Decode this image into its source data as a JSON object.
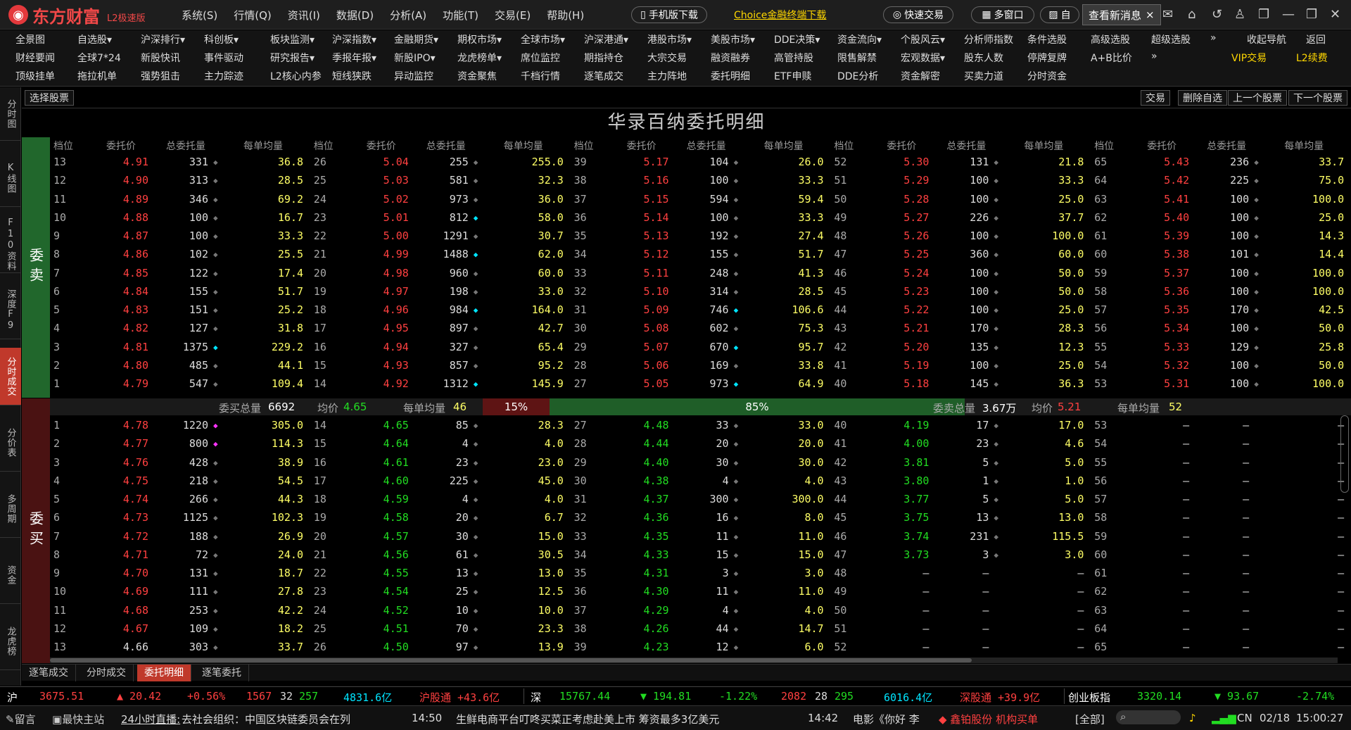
{
  "app": {
    "logo_text": "东方财富",
    "logo_sub": "L2极速版",
    "menu": [
      "系统(S)",
      "行情(Q)",
      "资讯(I)",
      "数据(D)",
      "分析(A)",
      "功能(T)",
      "交易(E)",
      "帮助(H)"
    ],
    "mobile_download": "手机版下载",
    "choice_link": "Choice金融终端下载",
    "quick_trade": "快速交易",
    "multi_window": "多窗口",
    "self_label": "自",
    "new_msg": "查看新消息",
    "close_x": "×"
  },
  "toolbar": {
    "row1": [
      "全景图",
      "自选股▾",
      "沪深排行▾",
      "科创板▾",
      "板块监测▾",
      "沪深指数▾",
      "金融期货▾",
      "期权市场▾",
      "全球市场▾",
      "沪深港通▾",
      "港股市场▾",
      "美股市场▾",
      "DDE决策▾",
      "资金流向▾",
      "个股风云▾",
      "分析师指数",
      "条件选股",
      "高级选股",
      "超级选股",
      "»",
      "收起导航",
      "返回"
    ],
    "row2": [
      "财经要闻",
      "全球7*24",
      "新股快讯",
      "事件驱动",
      "研究报告▾",
      "季报年报▾",
      "新股IPO▾",
      "龙虎榜单▾",
      "席位监控",
      "期指持仓",
      "大宗交易",
      "融资融券",
      "高管持股",
      "限售解禁",
      "宏观数据▾",
      "股东人数",
      "停牌复牌",
      "A+B比价",
      "»",
      "VIP交易",
      "L2续费"
    ],
    "row3": [
      "顶级挂单",
      "拖拉机单",
      "强势狙击",
      "主力踪迹",
      "L2核心内参",
      "短线狭跌",
      "异动监控",
      "资金聚焦",
      "千档行情",
      "逐笔成交",
      "主力阵地",
      "委托明细",
      "ETF申赎",
      "DDE分析",
      "资金解密",
      "买卖力道",
      "分时资金"
    ]
  },
  "left_tabs": [
    "分时图",
    "K线图",
    "F10资料",
    "深度F9",
    "分时成交",
    "分价表",
    "多周期",
    "资金",
    "龙虎榜"
  ],
  "subbar": {
    "select_stock": "选择股票",
    "trade": "交易",
    "remove_fav": "删除自选",
    "prev_stock": "上一个股票",
    "next_stock": "下一个股票"
  },
  "panel_title": "华录百纳委托明细",
  "columns": [
    "档位",
    "委托价",
    "总委托量",
    "每单均量"
  ],
  "sell_label": "委卖",
  "buy_label": "委买",
  "sell_rows": [
    [
      [
        "13",
        "4.91",
        "331",
        "g",
        "36.8"
      ],
      [
        "26",
        "5.04",
        "255",
        "g",
        "255.0"
      ],
      [
        "39",
        "5.17",
        "104",
        "g",
        "26.0"
      ],
      [
        "52",
        "5.30",
        "131",
        "g",
        "21.8"
      ],
      [
        "65",
        "5.43",
        "236",
        "g",
        "33.7"
      ]
    ],
    [
      [
        "12",
        "4.90",
        "313",
        "g",
        "28.5"
      ],
      [
        "25",
        "5.03",
        "581",
        "g",
        "32.3"
      ],
      [
        "38",
        "5.16",
        "100",
        "g",
        "33.3"
      ],
      [
        "51",
        "5.29",
        "100",
        "g",
        "33.3"
      ],
      [
        "64",
        "5.42",
        "225",
        "g",
        "75.0"
      ]
    ],
    [
      [
        "11",
        "4.89",
        "346",
        "g",
        "69.2"
      ],
      [
        "24",
        "5.02",
        "973",
        "g",
        "36.0"
      ],
      [
        "37",
        "5.15",
        "594",
        "g",
        "59.4"
      ],
      [
        "50",
        "5.28",
        "100",
        "g",
        "25.0"
      ],
      [
        "63",
        "5.41",
        "100",
        "g",
        "100.0"
      ]
    ],
    [
      [
        "10",
        "4.88",
        "100",
        "g",
        "16.7"
      ],
      [
        "23",
        "5.01",
        "812",
        "c",
        "58.0"
      ],
      [
        "36",
        "5.14",
        "100",
        "g",
        "33.3"
      ],
      [
        "49",
        "5.27",
        "226",
        "g",
        "37.7"
      ],
      [
        "62",
        "5.40",
        "100",
        "g",
        "25.0"
      ]
    ],
    [
      [
        "9",
        "4.87",
        "100",
        "g",
        "33.3"
      ],
      [
        "22",
        "5.00",
        "1291",
        "g",
        "30.7"
      ],
      [
        "35",
        "5.13",
        "192",
        "g",
        "27.4"
      ],
      [
        "48",
        "5.26",
        "100",
        "g",
        "100.0"
      ],
      [
        "61",
        "5.39",
        "100",
        "g",
        "14.3"
      ]
    ],
    [
      [
        "8",
        "4.86",
        "102",
        "g",
        "25.5"
      ],
      [
        "21",
        "4.99",
        "1488",
        "c",
        "62.0"
      ],
      [
        "34",
        "5.12",
        "155",
        "g",
        "51.7"
      ],
      [
        "47",
        "5.25",
        "360",
        "g",
        "60.0"
      ],
      [
        "60",
        "5.38",
        "101",
        "g",
        "14.4"
      ]
    ],
    [
      [
        "7",
        "4.85",
        "122",
        "g",
        "17.4"
      ],
      [
        "20",
        "4.98",
        "960",
        "g",
        "60.0"
      ],
      [
        "33",
        "5.11",
        "248",
        "g",
        "41.3"
      ],
      [
        "46",
        "5.24",
        "100",
        "g",
        "50.0"
      ],
      [
        "59",
        "5.37",
        "100",
        "g",
        "100.0"
      ]
    ],
    [
      [
        "6",
        "4.84",
        "155",
        "g",
        "51.7"
      ],
      [
        "19",
        "4.97",
        "198",
        "g",
        "33.0"
      ],
      [
        "32",
        "5.10",
        "314",
        "g",
        "28.5"
      ],
      [
        "45",
        "5.23",
        "100",
        "g",
        "50.0"
      ],
      [
        "58",
        "5.36",
        "100",
        "g",
        "100.0"
      ]
    ],
    [
      [
        "5",
        "4.83",
        "151",
        "g",
        "25.2"
      ],
      [
        "18",
        "4.96",
        "984",
        "c",
        "164.0"
      ],
      [
        "31",
        "5.09",
        "746",
        "c",
        "106.6"
      ],
      [
        "44",
        "5.22",
        "100",
        "g",
        "25.0"
      ],
      [
        "57",
        "5.35",
        "170",
        "g",
        "42.5"
      ]
    ],
    [
      [
        "4",
        "4.82",
        "127",
        "g",
        "31.8"
      ],
      [
        "17",
        "4.95",
        "897",
        "g",
        "42.7"
      ],
      [
        "30",
        "5.08",
        "602",
        "g",
        "75.3"
      ],
      [
        "43",
        "5.21",
        "170",
        "g",
        "28.3"
      ],
      [
        "56",
        "5.34",
        "100",
        "g",
        "50.0"
      ]
    ],
    [
      [
        "3",
        "4.81",
        "1375",
        "c",
        "229.2"
      ],
      [
        "16",
        "4.94",
        "327",
        "g",
        "65.4"
      ],
      [
        "29",
        "5.07",
        "670",
        "c",
        "95.7"
      ],
      [
        "42",
        "5.20",
        "135",
        "g",
        "12.3"
      ],
      [
        "55",
        "5.33",
        "129",
        "g",
        "25.8"
      ]
    ],
    [
      [
        "2",
        "4.80",
        "485",
        "g",
        "44.1"
      ],
      [
        "15",
        "4.93",
        "857",
        "g",
        "95.2"
      ],
      [
        "28",
        "5.06",
        "169",
        "g",
        "33.8"
      ],
      [
        "41",
        "5.19",
        "100",
        "g",
        "25.0"
      ],
      [
        "54",
        "5.32",
        "100",
        "g",
        "50.0"
      ]
    ],
    [
      [
        "1",
        "4.79",
        "547",
        "g",
        "109.4"
      ],
      [
        "14",
        "4.92",
        "1312",
        "c",
        "145.9"
      ],
      [
        "27",
        "5.05",
        "973",
        "c",
        "64.9"
      ],
      [
        "40",
        "5.18",
        "145",
        "g",
        "36.3"
      ],
      [
        "53",
        "5.31",
        "100",
        "g",
        "100.0"
      ]
    ]
  ],
  "summary": {
    "buy_total_label": "委买总量",
    "buy_total": "6692",
    "buy_avg_label": "均价",
    "buy_avg": "4.65",
    "buy_per_label": "每单均量",
    "buy_per": "46",
    "buy_pct": "15%",
    "sell_pct": "85%",
    "sell_total_label": "委卖总量",
    "sell_total": "3.67万",
    "sell_avg_label": "均价",
    "sell_avg": "5.21",
    "sell_per_label": "每单均量",
    "sell_per": "52"
  },
  "buy_rows": [
    [
      [
        "1",
        "4.78",
        "1220",
        "m",
        "305.0"
      ],
      [
        "14",
        "4.65",
        "85",
        "g",
        "28.3"
      ],
      [
        "27",
        "4.48",
        "33",
        "g",
        "33.0"
      ],
      [
        "40",
        "4.19",
        "17",
        "g",
        "17.0"
      ],
      [
        "53",
        "—",
        "—",
        "",
        "—"
      ]
    ],
    [
      [
        "2",
        "4.77",
        "800",
        "m",
        "114.3"
      ],
      [
        "15",
        "4.64",
        "4",
        "g",
        "4.0"
      ],
      [
        "28",
        "4.44",
        "20",
        "g",
        "20.0"
      ],
      [
        "41",
        "4.00",
        "23",
        "g",
        "4.6"
      ],
      [
        "54",
        "—",
        "—",
        "",
        "—"
      ]
    ],
    [
      [
        "3",
        "4.76",
        "428",
        "g",
        "38.9"
      ],
      [
        "16",
        "4.61",
        "23",
        "g",
        "23.0"
      ],
      [
        "29",
        "4.40",
        "30",
        "g",
        "30.0"
      ],
      [
        "42",
        "3.81",
        "5",
        "g",
        "5.0"
      ],
      [
        "55",
        "—",
        "—",
        "",
        "—"
      ]
    ],
    [
      [
        "4",
        "4.75",
        "218",
        "g",
        "54.5"
      ],
      [
        "17",
        "4.60",
        "225",
        "g",
        "45.0"
      ],
      [
        "30",
        "4.38",
        "4",
        "g",
        "4.0"
      ],
      [
        "43",
        "3.80",
        "1",
        "g",
        "1.0"
      ],
      [
        "56",
        "—",
        "—",
        "",
        "—"
      ]
    ],
    [
      [
        "5",
        "4.74",
        "266",
        "g",
        "44.3"
      ],
      [
        "18",
        "4.59",
        "4",
        "g",
        "4.0"
      ],
      [
        "31",
        "4.37",
        "300",
        "g",
        "300.0"
      ],
      [
        "44",
        "3.77",
        "5",
        "g",
        "5.0"
      ],
      [
        "57",
        "—",
        "—",
        "",
        "—"
      ]
    ],
    [
      [
        "6",
        "4.73",
        "1125",
        "g",
        "102.3"
      ],
      [
        "19",
        "4.58",
        "20",
        "g",
        "6.7"
      ],
      [
        "32",
        "4.36",
        "16",
        "g",
        "8.0"
      ],
      [
        "45",
        "3.75",
        "13",
        "g",
        "13.0"
      ],
      [
        "58",
        "—",
        "—",
        "",
        "—"
      ]
    ],
    [
      [
        "7",
        "4.72",
        "188",
        "g",
        "26.9"
      ],
      [
        "20",
        "4.57",
        "30",
        "g",
        "15.0"
      ],
      [
        "33",
        "4.35",
        "11",
        "g",
        "11.0"
      ],
      [
        "46",
        "3.74",
        "231",
        "g",
        "115.5"
      ],
      [
        "59",
        "—",
        "—",
        "",
        "—"
      ]
    ],
    [
      [
        "8",
        "4.71",
        "72",
        "g",
        "24.0"
      ],
      [
        "21",
        "4.56",
        "61",
        "g",
        "30.5"
      ],
      [
        "34",
        "4.33",
        "15",
        "g",
        "15.0"
      ],
      [
        "47",
        "3.73",
        "3",
        "g",
        "3.0"
      ],
      [
        "60",
        "—",
        "—",
        "",
        "—"
      ]
    ],
    [
      [
        "9",
        "4.70",
        "131",
        "g",
        "18.7"
      ],
      [
        "22",
        "4.55",
        "13",
        "g",
        "13.0"
      ],
      [
        "35",
        "4.31",
        "3",
        "g",
        "3.0"
      ],
      [
        "48",
        "—",
        "—",
        "",
        "—"
      ],
      [
        "61",
        "—",
        "—",
        "",
        "—"
      ]
    ],
    [
      [
        "10",
        "4.69",
        "111",
        "g",
        "27.8"
      ],
      [
        "23",
        "4.54",
        "25",
        "g",
        "12.5"
      ],
      [
        "36",
        "4.30",
        "11",
        "g",
        "11.0"
      ],
      [
        "49",
        "—",
        "—",
        "",
        "—"
      ],
      [
        "62",
        "—",
        "—",
        "",
        "—"
      ]
    ],
    [
      [
        "11",
        "4.68",
        "253",
        "g",
        "42.2"
      ],
      [
        "24",
        "4.52",
        "10",
        "g",
        "10.0"
      ],
      [
        "37",
        "4.29",
        "4",
        "g",
        "4.0"
      ],
      [
        "50",
        "—",
        "—",
        "",
        "—"
      ],
      [
        "63",
        "—",
        "—",
        "",
        "—"
      ]
    ],
    [
      [
        "12",
        "4.67",
        "109",
        "g",
        "18.2"
      ],
      [
        "25",
        "4.51",
        "70",
        "g",
        "23.3"
      ],
      [
        "38",
        "4.26",
        "44",
        "g",
        "14.7"
      ],
      [
        "51",
        "—",
        "—",
        "",
        "—"
      ],
      [
        "64",
        "—",
        "—",
        "",
        "—"
      ]
    ],
    [
      [
        "13",
        "4.66",
        "303",
        "g",
        "33.7"
      ],
      [
        "26",
        "4.50",
        "97",
        "g",
        "13.9"
      ],
      [
        "39",
        "4.23",
        "12",
        "g",
        "6.0"
      ],
      [
        "52",
        "—",
        "—",
        "",
        "—"
      ],
      [
        "65",
        "—",
        "—",
        "",
        "—"
      ]
    ]
  ],
  "bottom_tabs": [
    "逐笔成交",
    "分时成交",
    "委托明细",
    "逐笔委托"
  ],
  "index_bar": {
    "sh_label": "沪",
    "sh_value": "3675.51",
    "sh_change": "▲ 20.42",
    "sh_pct": "+0.56%",
    "sh_up": "1567",
    "sh_flat": "32",
    "sh_down": "257",
    "sh_amount": "4831.6亿",
    "sh_connect": "沪股通 +43.6亿",
    "sz_label": "深",
    "sz_value": "15767.44",
    "sz_change": "▼ 194.81",
    "sz_pct": "-1.22%",
    "sz_up": "2082",
    "sz_flat": "28",
    "sz_down": "295",
    "sz_amount": "6016.4亿",
    "sz_connect": "深股通 +39.9亿",
    "cy_label": "创业板指",
    "cy_value": "3320.14",
    "cy_change": "▼ 93.67",
    "cy_pct": "-2.74%"
  },
  "news_bar": {
    "message": "留言",
    "fast_main": "最快主站",
    "live": "24小时直播:",
    "news1": "去社会组织：中国区块链委员会在列",
    "time1": "14:50",
    "news2": "生鲜电商平台叮咚买菜正考虑赴美上市 筹资最多3亿美元",
    "time2": "14:42",
    "news3": "电影《你好 李",
    "alert_stock": "◆ 鑫铂股份 机构买单",
    "scope": "[全部]",
    "lang": "CN",
    "date": "02/18",
    "clock": "15:00:27"
  }
}
